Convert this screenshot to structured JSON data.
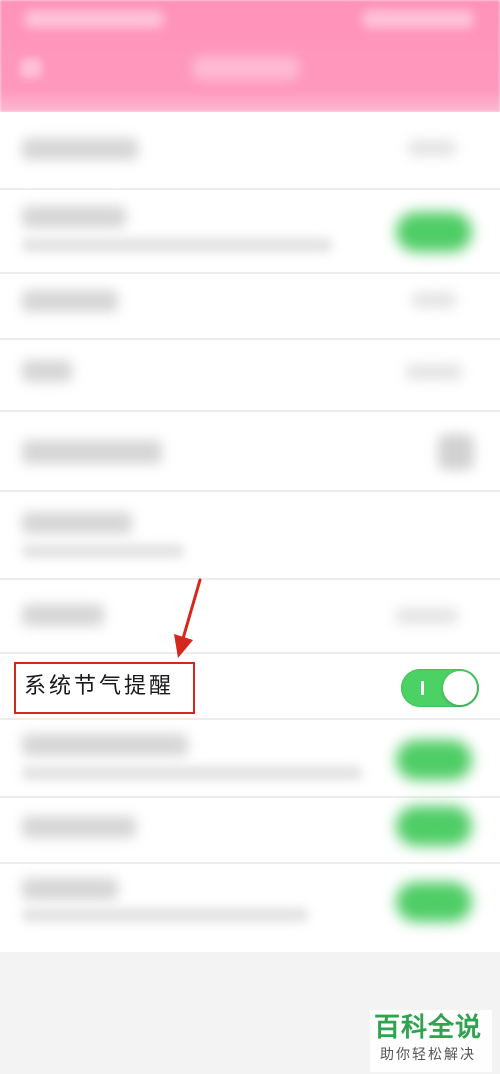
{
  "focused_setting": {
    "label": "系统节气提醒",
    "toggle_on": true,
    "toggle_on_color": "#4cd165"
  },
  "annotation": {
    "color": "#d6271f",
    "arrow": "arrow-down-icon"
  },
  "header": {
    "color": "#ff98bd"
  },
  "watermark": {
    "brand": "百科全说",
    "tagline": "助你轻松解决",
    "brand_color": "#2ea44f"
  }
}
